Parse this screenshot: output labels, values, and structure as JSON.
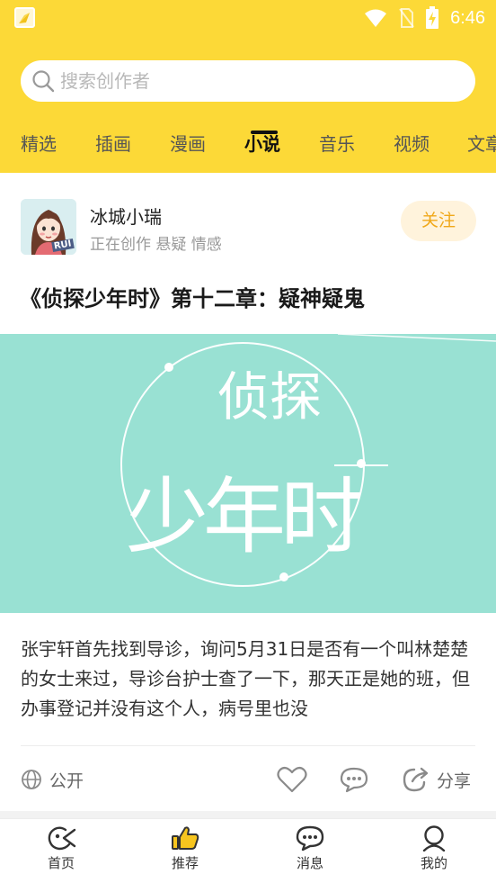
{
  "status_bar": {
    "time": "6:46"
  },
  "search": {
    "placeholder": "搜索创作者"
  },
  "tabs": [
    {
      "label": "精选"
    },
    {
      "label": "插画"
    },
    {
      "label": "漫画"
    },
    {
      "label": "小说",
      "active": true
    },
    {
      "label": "音乐"
    },
    {
      "label": "视频"
    },
    {
      "label": "文章"
    }
  ],
  "post": {
    "author": {
      "name": "冰城小瑞",
      "status": "正在创作 悬疑 情感",
      "avatar_badge": "RUI"
    },
    "follow_label": "关注",
    "title": "《侦探少年时》第十二章：疑神疑鬼",
    "cover_text": {
      "line1": "侦探",
      "line2": "少年时"
    },
    "excerpt": "张宇轩首先找到导诊，询问5月31日是否有一个叫林楚楚的女士来过，导诊台护士查了一下，那天正是她的班，但办事登记并没有这个人，病号里也没",
    "visibility_label": "公开",
    "share_label": "分享"
  },
  "bottom_nav": [
    {
      "label": "首页",
      "icon": "home-icon"
    },
    {
      "label": "推荐",
      "icon": "thumbs-up-icon",
      "active": true
    },
    {
      "label": "消息",
      "icon": "message-icon"
    },
    {
      "label": "我的",
      "icon": "profile-icon"
    }
  ],
  "colors": {
    "brand_yellow": "#fcd937",
    "cover_mint": "#99e1d3",
    "follow_text": "#f0a81a",
    "follow_bg": "#fff3dc"
  }
}
